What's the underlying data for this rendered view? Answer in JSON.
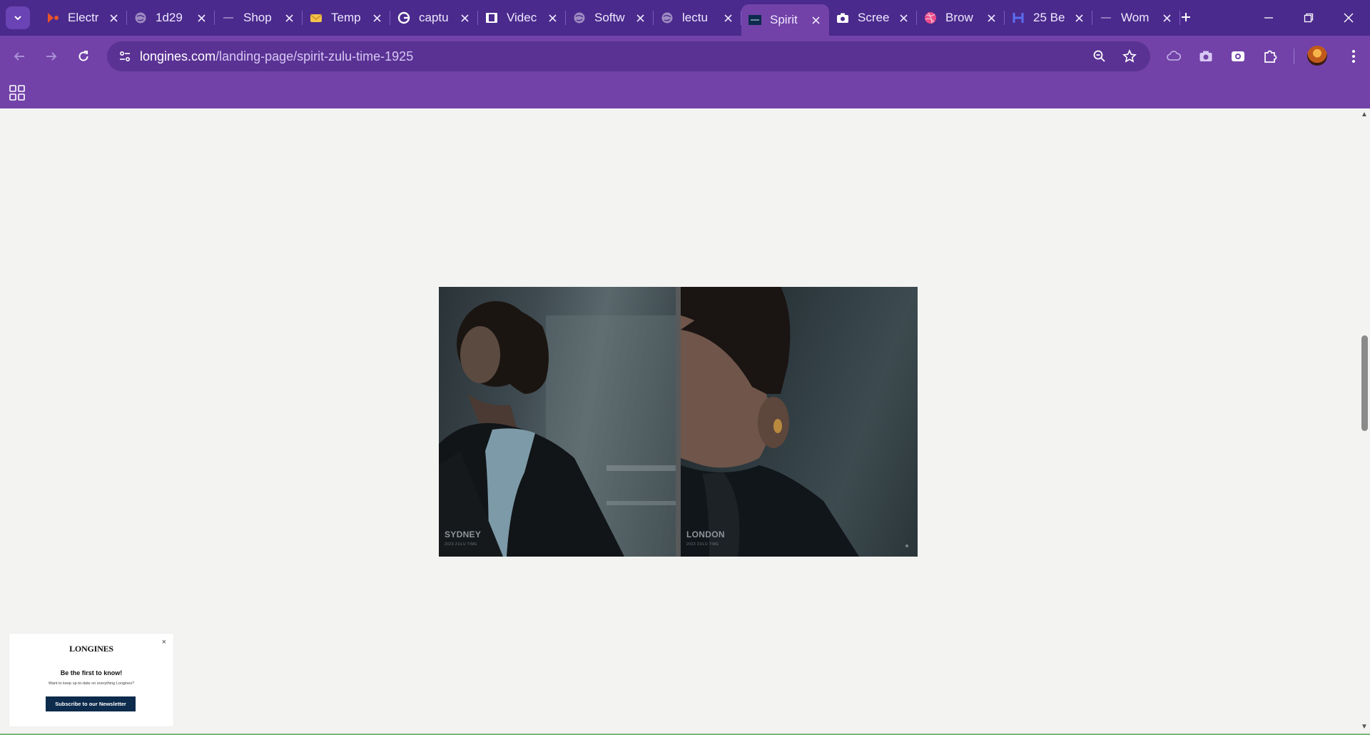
{
  "browser": {
    "tabs": [
      {
        "title": "Electr",
        "icon": "brand-icon",
        "icon_color": "#e8542a",
        "active": false
      },
      {
        "title": "1d29",
        "icon": "globe-icon",
        "icon_color": "#9d8bc2",
        "active": false
      },
      {
        "title": "Shop",
        "icon": "dash-icon",
        "icon_color": "#8f79bb",
        "active": false
      },
      {
        "title": "Temp",
        "icon": "envelope-icon",
        "icon_color": "#f2c24a",
        "active": false
      },
      {
        "title": "captu",
        "icon": "google-icon",
        "icon_color": "#ffffff",
        "active": false
      },
      {
        "title": "Videc",
        "icon": "film-icon",
        "icon_color": "#ffffff",
        "active": false
      },
      {
        "title": "Softw",
        "icon": "globe-icon",
        "icon_color": "#9d8bc2",
        "active": false
      },
      {
        "title": "lectu",
        "icon": "globe-icon",
        "icon_color": "#9d8bc2",
        "active": false
      },
      {
        "title": "Spirit",
        "icon": "longines-icon",
        "icon_color": "#0d2b4c",
        "active": true
      },
      {
        "title": "Scree",
        "icon": "camera-icon",
        "icon_color": "#ffffff",
        "active": false
      },
      {
        "title": "Brow",
        "icon": "dribbble-icon",
        "icon_color": "#ea4c89",
        "active": false
      },
      {
        "title": "25 Be",
        "icon": "h-icon",
        "icon_color": "#5b6cf0",
        "active": false
      },
      {
        "title": "Wom",
        "icon": "dash-icon",
        "icon_color": "#8f79bb",
        "active": false
      }
    ],
    "url_host": "longines.com",
    "url_path": "/landing-page/spirit-zulu-time-1925"
  },
  "video": {
    "left_city": "SYDNEY",
    "left_sub": "2023 ZULU TIME",
    "right_city": "LONDON",
    "right_sub": "2023 ZULU TIME"
  },
  "newsletter": {
    "logo": "LONGINES",
    "title": "Be the first to know!",
    "text": "Want to keep up-to-date on everything Longines?",
    "button": "Subscribe to our Newsletter",
    "close": "×"
  }
}
